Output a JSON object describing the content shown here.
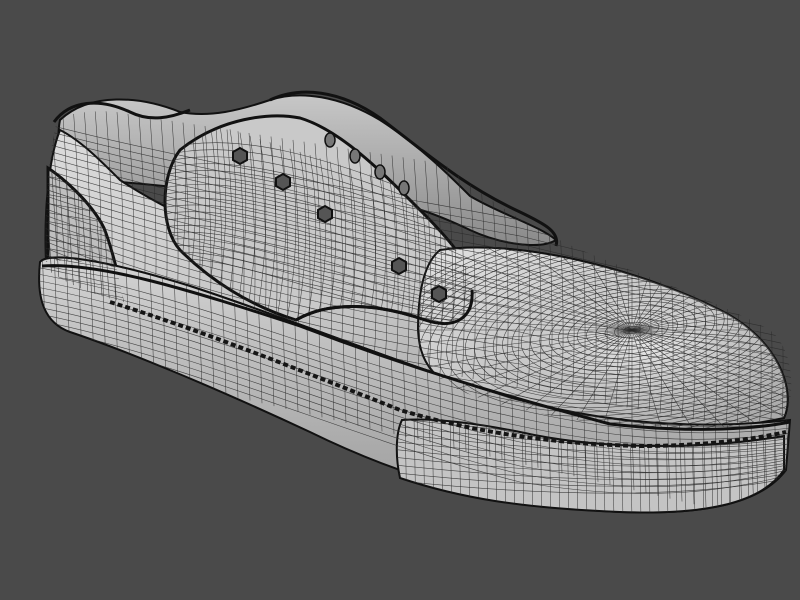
{
  "viewport": {
    "background_color": "#4a4a4a",
    "subject": "sneaker-wireframe-mesh"
  },
  "colors": {
    "upper_light": "#d2d2d2",
    "upper_mid": "#b9b9b9",
    "upper_dark": "#8e8e8e",
    "sole_light": "#cfcfcf",
    "sole_dark": "#9a9a9a",
    "interior": "#a9a9a9",
    "wire": "#2a2a2a",
    "outline": "#111111",
    "eyelet": "#555555"
  },
  "mesh": {
    "wire_density": "dense",
    "eyelet_count": 5,
    "eyelet_lace_holes_back": 4
  }
}
